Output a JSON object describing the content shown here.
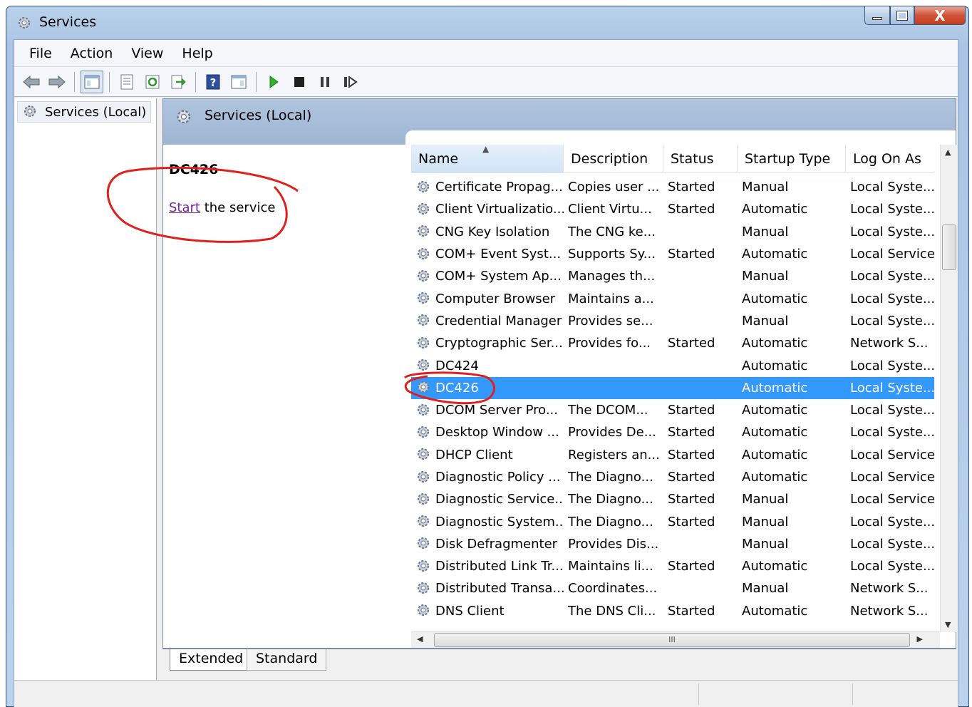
{
  "window": {
    "title": "Services",
    "close_glyph": "X",
    "colors": {
      "frame": "#a9c4e4",
      "close": "#c63c20",
      "selection": "#3399ff",
      "annotation": "#e0201c",
      "link": "#7a1fa0"
    }
  },
  "menu": {
    "items": [
      "File",
      "Action",
      "View",
      "Help"
    ]
  },
  "toolbar": {
    "icons": [
      "back-arrow-icon",
      "forward-arrow-icon",
      "show-hide-console-tree-icon",
      "properties-icon",
      "refresh-icon",
      "export-list-icon",
      "help-icon",
      "show-hide-action-pane-icon",
      "start-service-icon",
      "stop-service-icon",
      "pause-service-icon",
      "restart-service-icon"
    ]
  },
  "tree": {
    "root_label": "Services (Local)"
  },
  "pane": {
    "header_title": "Services (Local)",
    "selected_service": "DC426",
    "action_link": "Start",
    "action_rest": " the service"
  },
  "table": {
    "columns": [
      "Name",
      "Description",
      "Status",
      "Startup Type",
      "Log On As"
    ],
    "sorted_column": "Name",
    "rows": [
      [
        "Certificate Propag...",
        "Copies user ...",
        "Started",
        "Manual",
        "Local Syste..."
      ],
      [
        "Client Virtualizatio...",
        "Client Virtu...",
        "Started",
        "Automatic",
        "Local Syste..."
      ],
      [
        "CNG Key Isolation",
        "The CNG ke...",
        "",
        "Manual",
        "Local Syste..."
      ],
      [
        "COM+ Event Syst...",
        "Supports Sy...",
        "Started",
        "Automatic",
        "Local Service"
      ],
      [
        "COM+ System Ap...",
        "Manages th...",
        "",
        "Manual",
        "Local Syste..."
      ],
      [
        "Computer Browser",
        "Maintains a...",
        "",
        "Automatic",
        "Local Syste..."
      ],
      [
        "Credential Manager",
        "Provides se...",
        "",
        "Manual",
        "Local Syste..."
      ],
      [
        "Cryptographic Ser...",
        "Provides fo...",
        "Started",
        "Automatic",
        "Network S..."
      ],
      [
        "DC424",
        "",
        "",
        "Automatic",
        "Local Syste..."
      ],
      [
        "DC426",
        "",
        "",
        "Automatic",
        "Local Syste..."
      ],
      [
        "DCOM Server Pro...",
        "The DCOM...",
        "Started",
        "Automatic",
        "Local Syste..."
      ],
      [
        "Desktop Window ...",
        "Provides De...",
        "Started",
        "Automatic",
        "Local Syste..."
      ],
      [
        "DHCP Client",
        "Registers an...",
        "Started",
        "Automatic",
        "Local Service"
      ],
      [
        "Diagnostic Policy ...",
        "The Diagno...",
        "Started",
        "Automatic",
        "Local Service"
      ],
      [
        "Diagnostic Service...",
        "The Diagno...",
        "Started",
        "Manual",
        "Local Service"
      ],
      [
        "Diagnostic System...",
        "The Diagno...",
        "Started",
        "Manual",
        "Local Syste..."
      ],
      [
        "Disk Defragmenter",
        "Provides Dis...",
        "",
        "Manual",
        "Local Syste..."
      ],
      [
        "Distributed Link Tr...",
        "Maintains li...",
        "Started",
        "Automatic",
        "Local Syste..."
      ],
      [
        "Distributed Transa...",
        "Coordinates...",
        "",
        "Manual",
        "Network S..."
      ],
      [
        "DNS Client",
        "The DNS Cli...",
        "Started",
        "Automatic",
        "Network S..."
      ]
    ],
    "selected_row": 9,
    "hscroll_grip": "III"
  },
  "tabs": {
    "extended": "Extended",
    "standard": "Standard"
  }
}
